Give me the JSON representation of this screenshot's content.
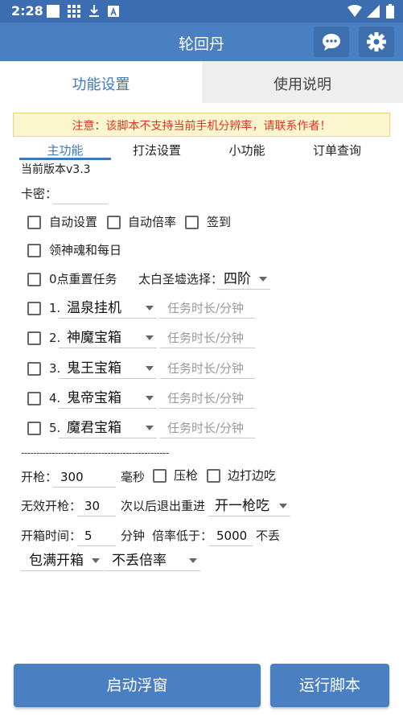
{
  "status_bar": {
    "time": "2:28"
  },
  "app_bar": {
    "title": "轮回丹"
  },
  "main_tabs": [
    {
      "label": "功能设置"
    },
    {
      "label": "使用说明"
    }
  ],
  "warning": "注意：该脚本不支持当前手机分辨率，请联系作者！",
  "sub_tabs": [
    {
      "label": "主功能"
    },
    {
      "label": "打法设置"
    },
    {
      "label": "小功能"
    },
    {
      "label": "订单查询"
    }
  ],
  "version": "当前版本v3.3",
  "card_label": "卡密：",
  "options": {
    "auto_settings": "自动设置",
    "auto_multiplier": "自动倍率",
    "check_in": "签到",
    "soul_daily": "领神魂和每日",
    "reset_tasks": "0点重置任务",
    "taibai_label": "太白圣墟选择：",
    "taibai_value": "四阶"
  },
  "tasks": [
    {
      "num": "1.",
      "name": "温泉挂机",
      "placeholder": "任务时长/分钟"
    },
    {
      "num": "2.",
      "name": "神魔宝箱",
      "placeholder": "任务时长/分钟"
    },
    {
      "num": "3.",
      "name": "鬼王宝箱",
      "placeholder": "任务时长/分钟"
    },
    {
      "num": "4.",
      "name": "鬼帝宝箱",
      "placeholder": "任务时长/分钟"
    },
    {
      "num": "5.",
      "name": "魔君宝箱",
      "placeholder": "任务时长/分钟"
    }
  ],
  "divider": "------------------------------------------------",
  "fire": {
    "label": "开枪：",
    "value": "300",
    "unit": "毫秒",
    "press_gun": "压枪",
    "eat_while_fighting": "边打边吃"
  },
  "invalid": {
    "label": "无效开枪：",
    "value": "30",
    "suffix": "次以后退出重进",
    "mode": "开一枪吃"
  },
  "box": {
    "label": "开箱时间：",
    "value": "5",
    "unit": "分钟",
    "rate_label": "倍率低于：",
    "rate_value": "5000",
    "suffix": "不丢"
  },
  "bottom_selects": {
    "box_mode": "包满开箱",
    "rate_mode": "不丢倍率"
  },
  "buttons": {
    "float": "启动浮窗",
    "run": "运行脚本"
  }
}
